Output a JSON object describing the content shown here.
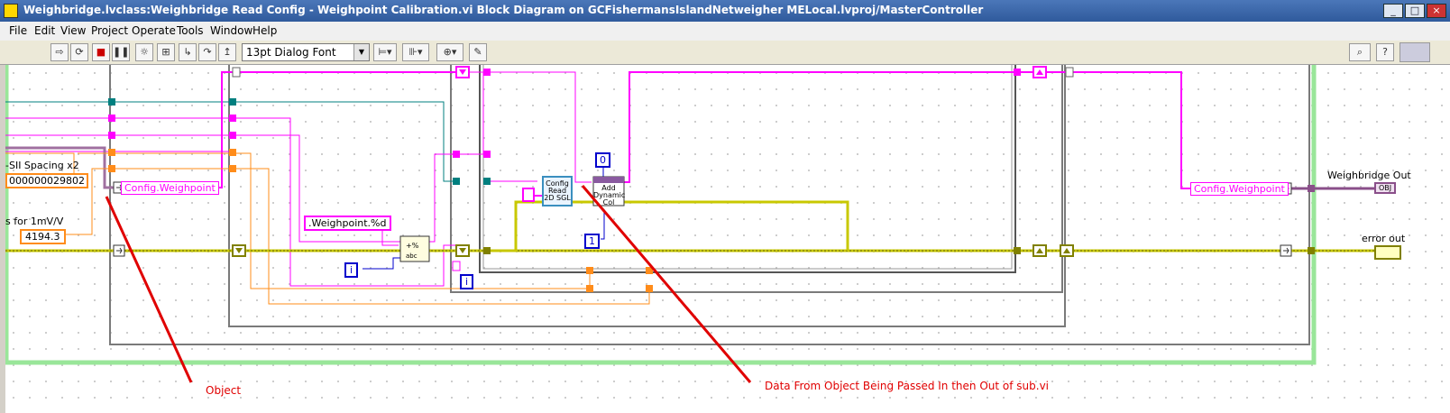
{
  "window": {
    "title": "Weighbridge.lvclass:Weighbridge Read Config - Weighpoint Calibration.vi Block Diagram on GCFishermansIslandNetweigher MELocal.lvproj/MasterController"
  },
  "menu": {
    "items": [
      "File",
      "Edit",
      "View",
      "Project",
      "Operate",
      "Tools",
      "Window",
      "Help"
    ]
  },
  "toolbar": {
    "font_select": "13pt Dialog Font"
  },
  "diagram": {
    "spacing_label": "-SII Spacing x2",
    "spacing_value": "000000029802",
    "mv_label": "s for 1mV/V",
    "mv_value": "4194.3",
    "config_weighpoint_left": "Config.Weighpoint",
    "config_weighpoint_right": "Config.Weighpoint",
    "format_string": ".Weighpoint.%d",
    "index_i": "i",
    "loop_i": "i",
    "const_0": "0",
    "const_1": "1",
    "config_read_node": "Config Read 2D SGL",
    "add_dynamic_col_node": "Add Dynamic Col",
    "weighbridge_out_label": "Weighbridge Out",
    "weighbridge_out_term": "OBJ",
    "error_out_label": "error out"
  },
  "annotations": {
    "object": "Object",
    "data_flow": "Data From Object Being Passed In then Out of sub.vi"
  },
  "colors": {
    "object_wire": "#ff00ff",
    "error_wire": "#cccc00",
    "numeric_wire": "#ff8c1a",
    "refnum_wire": "#007f7f",
    "annotation": "#e00000"
  }
}
